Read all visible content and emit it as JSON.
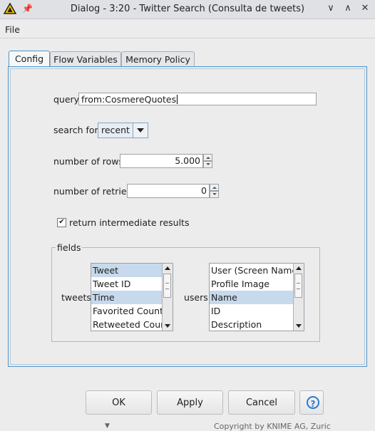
{
  "window": {
    "title": "Dialog - 3:20 - Twitter Search (Consulta de tweets)",
    "app_icon": "warning-triangle-icon",
    "pin_icon": "pin-icon",
    "minimize_glyph": "∨",
    "maximize_glyph": "∧",
    "close_glyph": "✕"
  },
  "menu": {
    "file": "File"
  },
  "tabs": [
    {
      "label": "Config",
      "active": true
    },
    {
      "label": "Flow Variables",
      "active": false
    },
    {
      "label": "Memory Policy",
      "active": false
    }
  ],
  "config": {
    "query_label": "query",
    "query_value": "from:CosmereQuotes",
    "search_for_label": "search for",
    "search_for_value": "recent",
    "rows_label": "number of rows",
    "rows_value": "5.000",
    "retries_label": "number of retries",
    "retries_value": "0",
    "intermediate_label": "return intermediate results",
    "intermediate_checked": true,
    "fields_legend": "fields",
    "tweets_label": "tweets",
    "users_label": "users",
    "tweet_fields": [
      {
        "label": "Tweet",
        "selected": true
      },
      {
        "label": "Tweet ID",
        "selected": false
      },
      {
        "label": "Time",
        "selected": true
      },
      {
        "label": "Favorited Count",
        "selected": false
      },
      {
        "label": "Retweeted Count",
        "selected": false
      }
    ],
    "user_fields": [
      {
        "label": "User (Screen Name)",
        "selected": false
      },
      {
        "label": "Profile Image",
        "selected": false
      },
      {
        "label": "Name",
        "selected": true
      },
      {
        "label": "ID",
        "selected": false
      },
      {
        "label": "Description",
        "selected": false
      }
    ]
  },
  "buttons": {
    "ok": "OK",
    "apply": "Apply",
    "cancel": "Cancel",
    "help": "?"
  },
  "footer": {
    "partial_text": "Copyright by KNIME AG, Zuric"
  },
  "colors": {
    "accent": "#4f95c9",
    "selection": "#c7d9ec",
    "help": "#2a7bd1",
    "logo": "#f2c200"
  }
}
